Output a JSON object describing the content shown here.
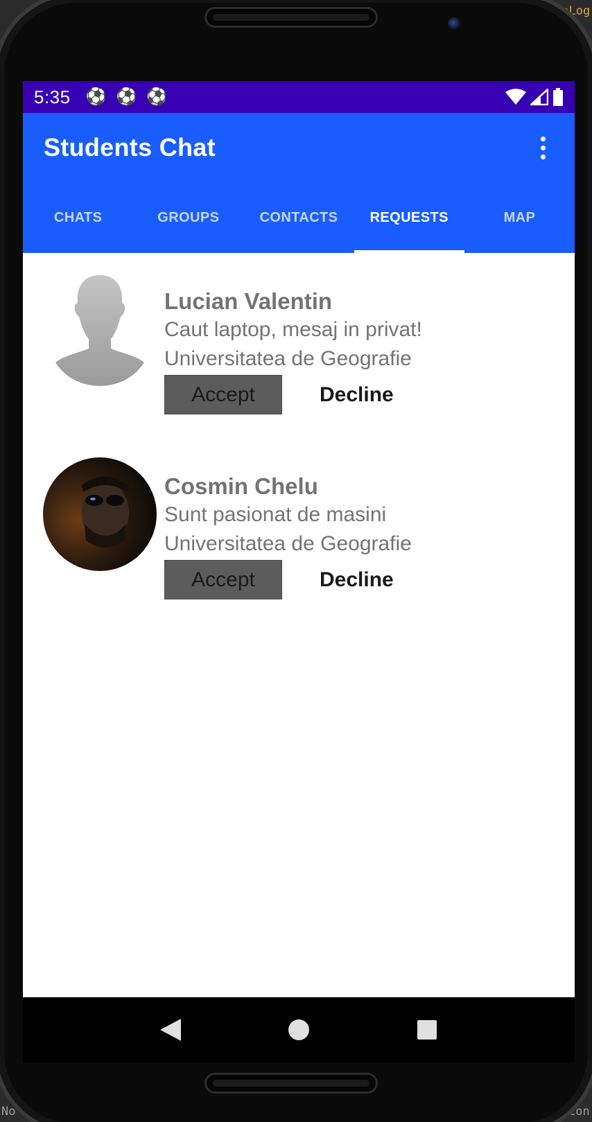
{
  "status_bar": {
    "time": "5:35",
    "notification_icons": [
      "soccer-ball-icon",
      "soccer-ball-icon",
      "soccer-ball-icon"
    ],
    "right_icons": [
      "wifi-icon",
      "cell-signal-icon",
      "battery-icon"
    ],
    "color": "#3700b3"
  },
  "app_bar": {
    "title": "Students Chat",
    "overflow_icon": "more-vert-icon",
    "color": "#1a5dff"
  },
  "tabs": [
    {
      "label": "CHATS",
      "active": false
    },
    {
      "label": "GROUPS",
      "active": false
    },
    {
      "label": "CONTACTS",
      "active": false
    },
    {
      "label": "REQUESTS",
      "active": true
    },
    {
      "label": "MAP",
      "active": false
    }
  ],
  "requests": [
    {
      "name": "Lucian Valentin",
      "status": "Caut laptop, mesaj in privat!",
      "university": "Universitatea de Geografie",
      "avatar": "default-avatar-icon",
      "accept_label": "Accept",
      "decline_label": "Decline"
    },
    {
      "name": "Cosmin Chelu",
      "status": "Sunt pasionat de masini",
      "university": "Universitatea de Geografie",
      "avatar": "profile-photo",
      "accept_label": "Accept",
      "decline_label": "Decline"
    }
  ],
  "nav_bar": {
    "buttons": [
      "back-icon",
      "home-icon",
      "recents-icon"
    ]
  },
  "ide_background": {
    "top_right_text": "ToLog",
    "bottom_left_text": "No",
    "bottom_right_text": "Con"
  }
}
